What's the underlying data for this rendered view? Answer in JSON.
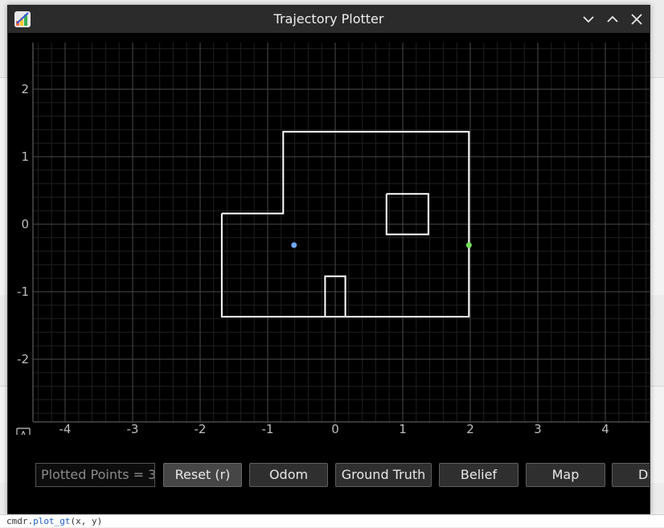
{
  "window": {
    "title": "Trajectory Plotter"
  },
  "autoscale_label": "A",
  "plot": {
    "x_ticks": [
      "-4",
      "-3",
      "-2",
      "-1",
      "0",
      "1",
      "2",
      "3",
      "4"
    ],
    "y_ticks": [
      "2",
      "1",
      "0",
      "-1",
      "-2"
    ]
  },
  "chart_data": {
    "type": "line",
    "x_range": [
      -4.5,
      4.7
    ],
    "y_range": [
      -2.95,
      2.6
    ],
    "grid": true,
    "map_segments": [
      [
        [
          -1.68,
          0.16
        ],
        [
          -0.77,
          0.16
        ],
        [
          -0.77,
          1.37
        ],
        [
          1.98,
          1.37
        ],
        [
          1.98,
          -1.37
        ],
        [
          -1.68,
          -1.37
        ],
        [
          -1.68,
          0.16
        ]
      ],
      [
        [
          0.76,
          0.45
        ],
        [
          1.38,
          0.45
        ],
        [
          1.38,
          -0.15
        ],
        [
          0.76,
          -0.15
        ],
        [
          0.76,
          0.45
        ]
      ],
      [
        [
          -0.15,
          -1.37
        ],
        [
          -0.15,
          -0.77
        ],
        [
          0.15,
          -0.77
        ],
        [
          0.15,
          -1.37
        ]
      ]
    ],
    "points": [
      {
        "x": -0.61,
        "y": -0.31,
        "color": "#6fa8ff"
      },
      {
        "x": 1.98,
        "y": -0.31,
        "color": "#73e05a"
      }
    ]
  },
  "controls": {
    "plotted_points": "Plotted Points = 3",
    "buttons": [
      "Reset (r)",
      "Odom",
      "Ground Truth",
      "Belief",
      "Map",
      "Di"
    ]
  },
  "status_bar": {
    "prefix": "cmdr.",
    "fn": "plot_gt",
    "args": "(x, y)"
  }
}
